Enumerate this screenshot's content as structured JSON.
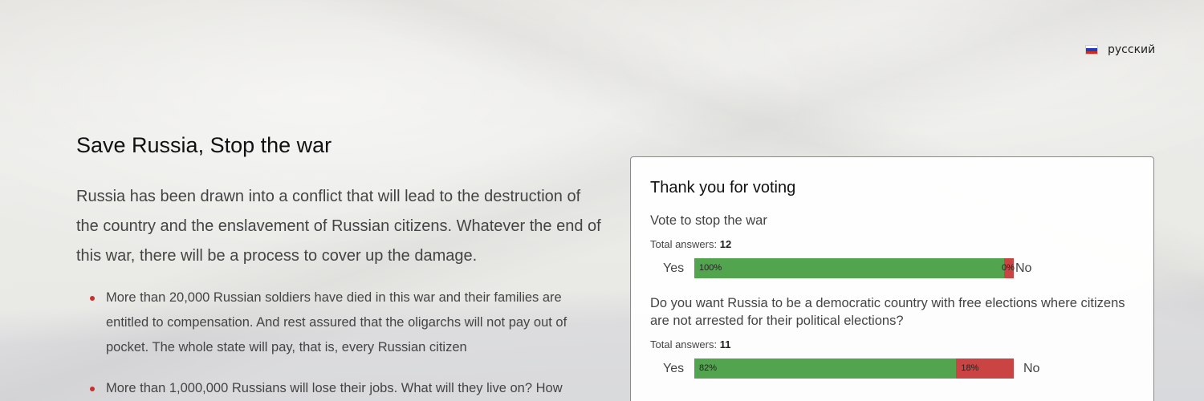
{
  "language": {
    "label": "русский",
    "flag_icon": "russia-flag-icon"
  },
  "main": {
    "title": "Save Russia, Stop the war",
    "lead": "Russia has been drawn into a conflict that will lead to the destruction of the country and the enslavement of Russian citizens. Whatever the end of this war, there will be a process to cover up the damage.",
    "bullets": [
      "More than 20,000 Russian soldiers have died in this war and their families are entitled to compensation. And rest assured that the oligarchs will not pay out of pocket. The whole state will pay, that is, every Russian citizen",
      "More than 1,000,000 Russians will lose their jobs. What will they live on? How"
    ]
  },
  "poll": {
    "title": "Thank you for voting",
    "total_label": "Total answers:",
    "questions": [
      {
        "question": "Vote to stop the war",
        "total": "12",
        "yes_label": "Yes",
        "no_label": "No",
        "yes_percent": 97,
        "yes_text": "100%",
        "no_text": "0%"
      },
      {
        "question": "Do you want Russia to be a democratic country with free elections where citizens are not arrested for their political elections?",
        "total": "11",
        "yes_label": "Yes",
        "no_label": "No",
        "yes_percent": 82,
        "yes_text": "82%",
        "no_text": "18%"
      }
    ]
  },
  "colors": {
    "yes": "#52a44e",
    "no": "#c94442",
    "bullet": "#c9302c"
  }
}
